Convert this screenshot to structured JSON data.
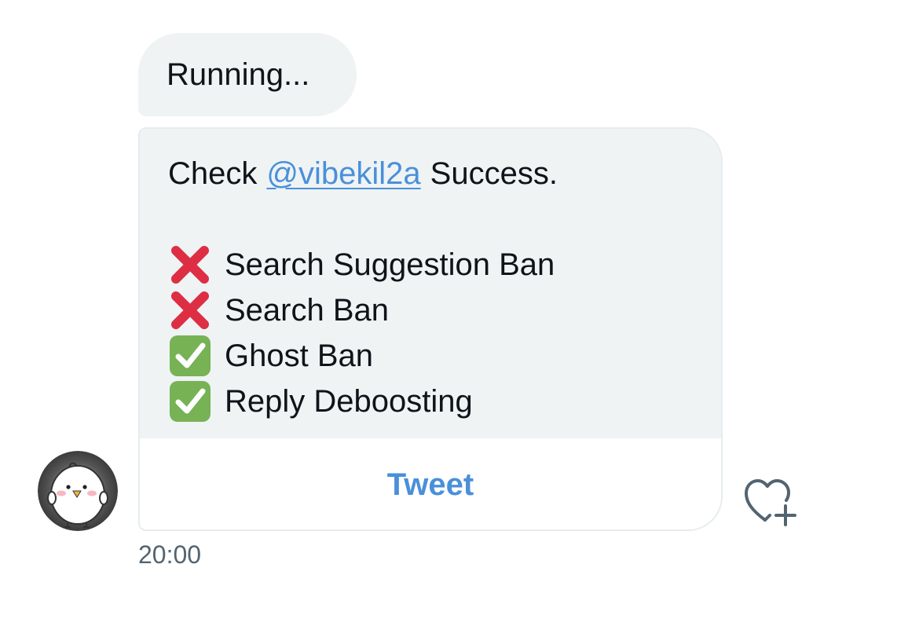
{
  "messages": {
    "running_text": "Running...",
    "card": {
      "check_prefix": "Check",
      "mention": "@vibekil2a",
      "check_suffix": "Success.",
      "results": [
        {
          "icon": "cross-mark-icon",
          "label": "Search Suggestion Ban"
        },
        {
          "icon": "cross-mark-icon",
          "label": "Search Ban"
        },
        {
          "icon": "check-mark-icon",
          "label": "Ghost Ban"
        },
        {
          "icon": "check-mark-icon",
          "label": "Reply Deboosting"
        }
      ],
      "tweet_button_label": "Tweet"
    },
    "timestamp": "20:00"
  },
  "colors": {
    "bubble_bg": "#eff3f4",
    "link": "#4a90d9",
    "cross": "#dd2e44",
    "check": "#77b255",
    "muted_text": "#536471"
  }
}
